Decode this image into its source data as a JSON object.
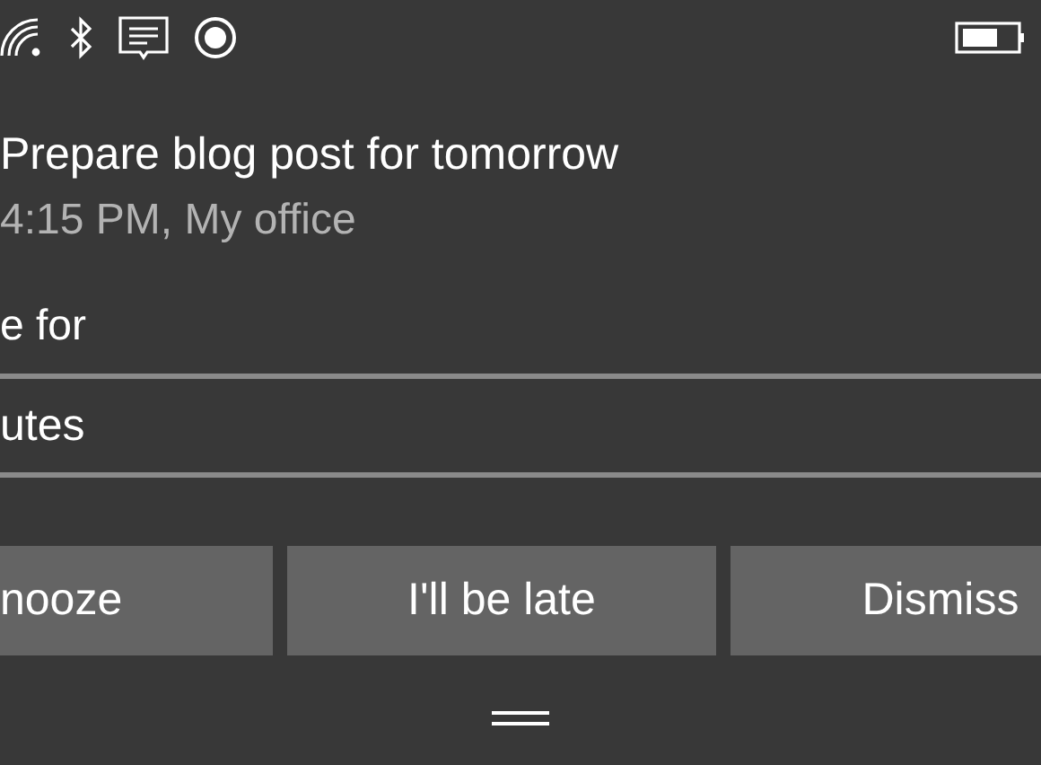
{
  "reminder": {
    "title": "Prepare blog post for tomorrow",
    "details": "4:15 PM, My office"
  },
  "snooze": {
    "label": "e for",
    "value": "utes"
  },
  "buttons": [
    "nooze",
    "I'll be late",
    "Dismiss"
  ]
}
